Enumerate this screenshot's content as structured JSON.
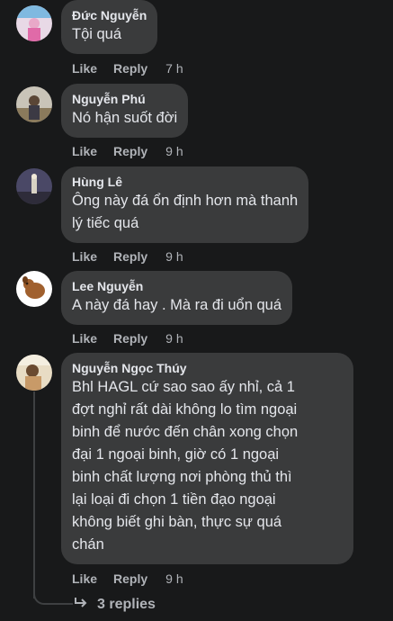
{
  "comments": [
    {
      "author": "Đức Nguyễn",
      "lines": [
        "Tội quá"
      ],
      "like": "Like",
      "reply": "Reply",
      "time": "7 h"
    },
    {
      "author": "Nguyễn Phú",
      "lines": [
        "Nó hận suốt đời"
      ],
      "like": "Like",
      "reply": "Reply",
      "time": "9 h"
    },
    {
      "author": "Hùng Lê",
      "lines": [
        "Ông này đá ổn định hơn mà thanh",
        "lý tiếc quá"
      ],
      "like": "Like",
      "reply": "Reply",
      "time": "9 h"
    },
    {
      "author": "Lee Nguyễn",
      "lines": [
        "A này đá hay . Mà ra đi uổn quá"
      ],
      "like": "Like",
      "reply": "Reply",
      "time": "9 h"
    },
    {
      "author": "Nguyễn Ngọc Thúy",
      "lines": [
        "Bhl HAGL cứ sao sao ấy nhỉ, cả 1",
        "đợt nghỉ rất dài không lo tìm ngoại",
        "binh để nước đến chân xong chọn",
        "đại 1 ngoại binh, giờ có 1 ngoại",
        "binh chất lượng nơi phòng thủ thì",
        "lại loại đi chọn 1 tiền đạo ngoại",
        "không biết ghi bàn, thực sự quá",
        "chán"
      ],
      "like": "Like",
      "reply": "Reply",
      "time": "9 h"
    }
  ],
  "replies_link": "3 replies",
  "reply_arrow_icon": "reply-arrow-icon"
}
